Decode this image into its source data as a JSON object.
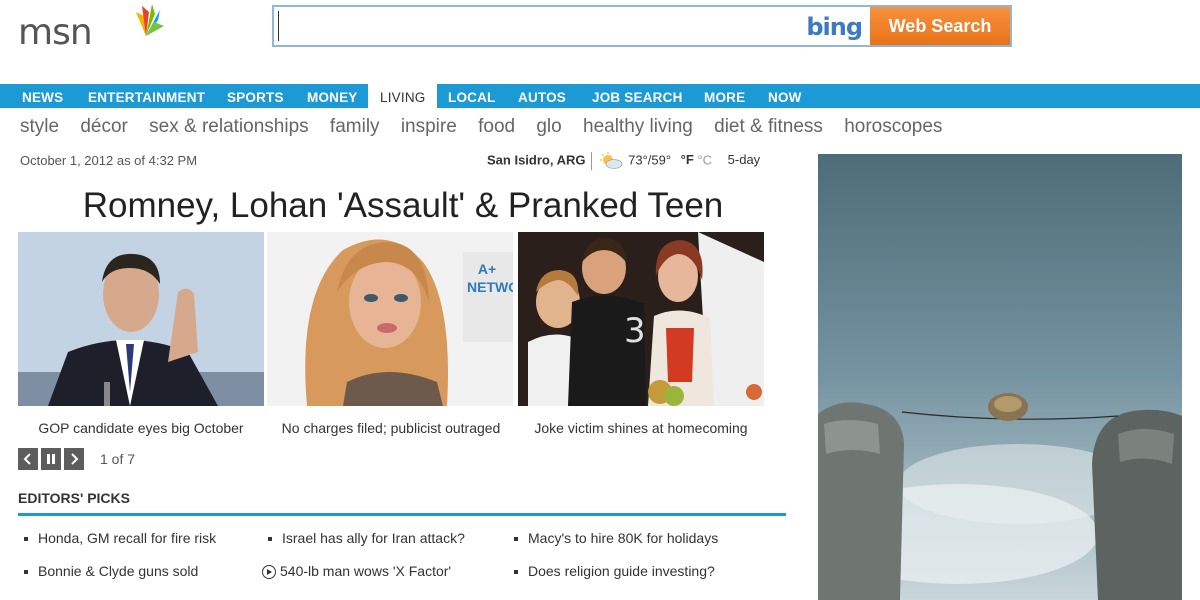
{
  "header": {
    "logo_text": "msn",
    "bing_label": "bing",
    "search": {
      "value": "",
      "placeholder": ""
    },
    "search_button": "Web Search"
  },
  "nav": {
    "items": [
      "NEWS",
      "ENTERTAINMENT",
      "SPORTS",
      "MONEY",
      "LIVING",
      "LOCAL",
      "AUTOS",
      "JOB SEARCH",
      "MORE",
      "NOW"
    ],
    "active": "LIVING"
  },
  "subnav": {
    "items": [
      "style",
      "décor",
      "sex & relationships",
      "family",
      "inspire",
      "food",
      "glo",
      "healthy living",
      "diet & fitness",
      "horoscopes"
    ]
  },
  "dateline": "October 1, 2012 as of 4:32 PM",
  "weather": {
    "location": "San Isidro, ARG",
    "temps": "73°/59°",
    "unit_f": "°F",
    "unit_c": "°C",
    "forecast_link": "5-day",
    "icon": "partly-cloudy-icon"
  },
  "slideshow": {
    "headline": "Romney, Lohan 'Assault' & Pranked Teen",
    "captions": [
      "GOP candidate eyes big October",
      "No charges filed; publicist outraged",
      "Joke victim shines at homecoming"
    ],
    "photo_text": "A+ NETWO",
    "counter": "1 of 7"
  },
  "editors_picks": {
    "title": "EDITORS' PICKS",
    "columns": [
      [
        "Honda, GM recall for fire risk",
        "Bonnie & Clyde guns sold"
      ],
      [
        "Israel has ally for Iran attack?",
        "540-lb man wows 'X Factor'"
      ],
      [
        "Macy's to hire 80K for holidays",
        "Does religion guide investing?"
      ]
    ]
  },
  "colors": {
    "nav_blue": "#1b9ad6",
    "search_orange": "#f28a2e",
    "bing_blue": "#3b7bbf"
  }
}
